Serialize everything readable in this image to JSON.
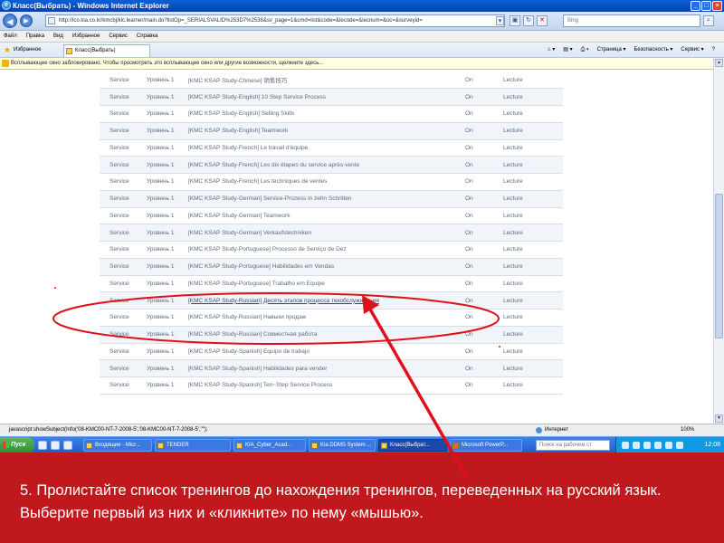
{
  "window": {
    "title": "Класс(Выбрать) - Windows Internet Explorer",
    "min": "_",
    "max": "□",
    "close": "×"
  },
  "nav": {
    "back": "◀",
    "forward": "▶",
    "address": "http://lco.kia.co.kr/kmcbj/klc.learner/main.do?listOp=_SERIALSVALID%253D7%2538&sv_page=1&cmd=list&code=&lecode=&lecnum=&oc=&surveyid=",
    "search_placeholder": "Bing"
  },
  "menu": [
    "Файл",
    "Правка",
    "Вид",
    "Избранное",
    "Сервис",
    "Справка"
  ],
  "favorites": {
    "label": "Избранное",
    "tab": "Класс(Выбрать)",
    "commands": [
      "Страница ▾",
      "Безопасность ▾",
      "Сервис ▾",
      "?"
    ]
  },
  "infobar": "Всплывающее окно заблокировано. Чтобы просмотреть это всплывающее окно или другие возможности, щелкните здесь...",
  "courses": [
    {
      "dept": "Service",
      "level": "Уровень 1",
      "title": "[KMC KSAP Study-Chinese] 销售技巧",
      "state": "On",
      "method": "Lecture"
    },
    {
      "dept": "Service",
      "level": "Уровень 1",
      "title": "[KMC KSAP Study-English] 10 Step Service Process",
      "state": "On",
      "method": "Lecture"
    },
    {
      "dept": "Service",
      "level": "Уровень 1",
      "title": "[KMC KSAP Study-English] Selling Skills",
      "state": "On",
      "method": "Lecture"
    },
    {
      "dept": "Service",
      "level": "Уровень 1",
      "title": "[KMC KSAP Study-English] Teamwork",
      "state": "On",
      "method": "Lecture"
    },
    {
      "dept": "Service",
      "level": "Уровень 1",
      "title": "[KMC KSAP Study-French] Le travail d'équipe",
      "state": "On",
      "method": "Lecture"
    },
    {
      "dept": "Service",
      "level": "Уровень 1",
      "title": "[KMC KSAP Study-French] Les dix étapes du service après-vente",
      "state": "On",
      "method": "Lecture"
    },
    {
      "dept": "Service",
      "level": "Уровень 1",
      "title": "[KMC KSAP Study-French] Les techniques de ventes",
      "state": "On",
      "method": "Lecture"
    },
    {
      "dept": "Service",
      "level": "Уровень 1",
      "title": "[KMC KSAP Study-German] Service-Prozess in zehn Schritten",
      "state": "On",
      "method": "Lecture"
    },
    {
      "dept": "Service",
      "level": "Уровень 1",
      "title": "[KMC KSAP Study-German] Teamwork",
      "state": "On",
      "method": "Lecture"
    },
    {
      "dept": "Service",
      "level": "Уровень 1",
      "title": "[KMC KSAP Study-German] Verkaufstechniken",
      "state": "On",
      "method": "Lecture"
    },
    {
      "dept": "Service",
      "level": "Уровень 1",
      "title": "[KMC KSAP Study-Portuguese] Processo de Serviço de Dez",
      "state": "On",
      "method": "Lecture"
    },
    {
      "dept": "Service",
      "level": "Уровень 1",
      "title": "[KMC KSAP Study-Portuguese] Habilidades em Vendas",
      "state": "On",
      "method": "Lecture"
    },
    {
      "dept": "Service",
      "level": "Уровень 1",
      "title": "[KMC KSAP Study-Portuguese] Trabalho em Equipe",
      "state": "On",
      "method": "Lecture"
    },
    {
      "dept": "Service",
      "level": "Уровень 1",
      "title": "[KMC KSAP Study-Russian] Десять этапов процесса техобслуживания",
      "state": "On",
      "method": "Lecture"
    },
    {
      "dept": "Service",
      "level": "Уровень 1",
      "title": "[KMC KSAP Study-Russian] Навыки продаж",
      "state": "On",
      "method": "Lecture"
    },
    {
      "dept": "Service",
      "level": "Уровень 1",
      "title": "[KMC KSAP Study-Russian] Совместная работа",
      "state": "On",
      "method": "Lecture"
    },
    {
      "dept": "Service",
      "level": "Уровень 1",
      "title": "[KMC KSAP Study-Spanish] Equipo de trabajo",
      "state": "On",
      "method": "Lecture"
    },
    {
      "dept": "Service",
      "level": "Уровень 1",
      "title": "[KMC KSAP Study-Spanish] Habilidades para vender",
      "state": "On",
      "method": "Lecture"
    },
    {
      "dept": "Service",
      "level": "Уровень 1",
      "title": "[KMC KSAP Study-Spanish] Ten~Step Service Process",
      "state": "On",
      "method": "Lecture"
    }
  ],
  "status": {
    "url": "javascript:showSubject(Info('08-KMC00-NT-7-2008-5','08-KMC00-NT-7-2008-5',\"\");",
    "zone": "Интернет",
    "zoom": "100%"
  },
  "taskbar": {
    "start": "Пуск",
    "buttons": [
      "Входящие - Micr...",
      "TENDER",
      "KIA_Cyber_Acad...",
      "Kia DDMS System ...",
      "Класс(Выбрат...",
      "Microsoft PowerP..."
    ],
    "search_placeholder": "Поиск на рабочем ст",
    "clock": "12:08"
  },
  "instruction": "5. Пролистайте список тренингов до нахождения тренингов, переведенных на русский язык.   Выберите первый из них и «кликните» по нему «мышью».",
  "colors": {
    "accent_red": "#c0181d",
    "annotation_red": "#e0101a",
    "titlebar_blue": "#0a5fd8"
  }
}
